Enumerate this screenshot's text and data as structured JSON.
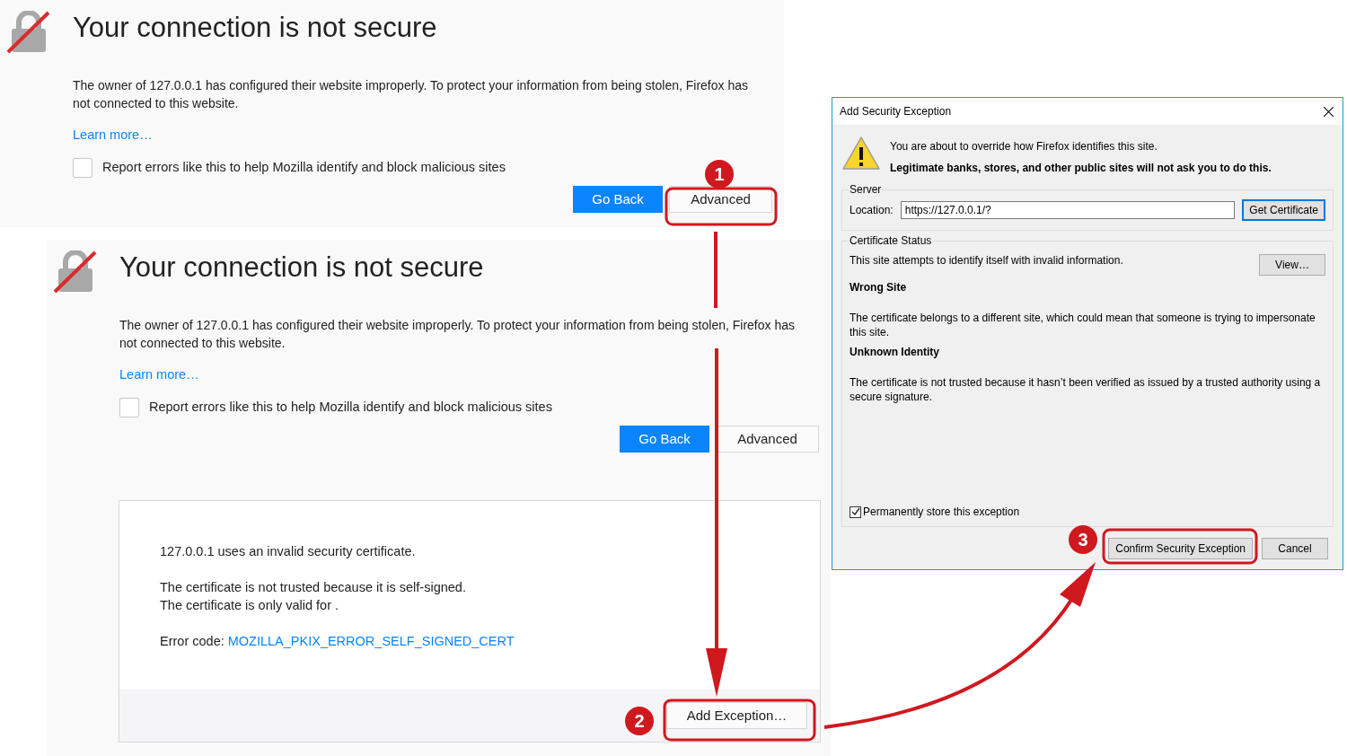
{
  "error_pages": [
    {
      "title": "Your connection is not secure",
      "description": "The owner of 127.0.0.1 has configured their website improperly. To protect your information from being stolen, Firefox has not connected to this website.",
      "learn_more": "Learn more…",
      "report": {
        "label": "Report errors like this to help Mozilla identify and block malicious sites",
        "checked": false
      },
      "buttons": [
        {
          "label": "Go Back",
          "kind": "primary"
        },
        {
          "label": "Advanced",
          "kind": "secondary"
        }
      ]
    },
    {
      "title": "Your connection is not secure",
      "description": "The owner of 127.0.0.1 has configured their website improperly. To protect your information from being stolen, Firefox has not connected to this website.",
      "learn_more": "Learn more…",
      "report": {
        "label": "Report errors like this to help Mozilla identify and block malicious sites",
        "checked": false
      },
      "buttons": [
        {
          "label": "Go Back",
          "kind": "primary"
        },
        {
          "label": "Advanced",
          "kind": "secondary"
        }
      ],
      "advanced": {
        "lines": [
          "127.0.0.1 uses an invalid security certificate.",
          "The certificate is not trusted because it is self-signed.",
          "The certificate is only valid for ."
        ],
        "error_code_label": "Error code:",
        "error_code": "MOZILLA_PKIX_ERROR_SELF_SIGNED_CERT",
        "button": "Add Exception…"
      }
    }
  ],
  "dialog": {
    "title": "Add Security Exception",
    "warning": "You are about to override how Firefox identifies this site.",
    "warning_bold": "Legitimate banks, stores, and other public sites will not ask you to do this.",
    "server": {
      "legend": "Server",
      "location_label": "Location:",
      "location_value": "https://127.0.0.1/?",
      "button": "Get Certificate"
    },
    "status": {
      "legend": "Certificate Status",
      "summary": "This site attempts to identify itself with invalid information.",
      "button": "View…",
      "sections": [
        {
          "heading": "Wrong Site",
          "text": "The certificate belongs to a different site, which could mean that someone is trying to impersonate this site."
        },
        {
          "heading": "Unknown Identity",
          "text": "The certificate is not trusted because it hasn’t been verified as issued by a trusted authority using a secure signature."
        }
      ],
      "permanent": {
        "label": "Permanently store this exception",
        "checked": true
      }
    },
    "buttons": [
      {
        "label": "Confirm Security Exception",
        "kind": "default"
      },
      {
        "label": "Cancel",
        "kind": "normal"
      }
    ]
  },
  "annotations": [
    {
      "number": "1"
    },
    {
      "number": "2"
    },
    {
      "number": "3"
    }
  ]
}
